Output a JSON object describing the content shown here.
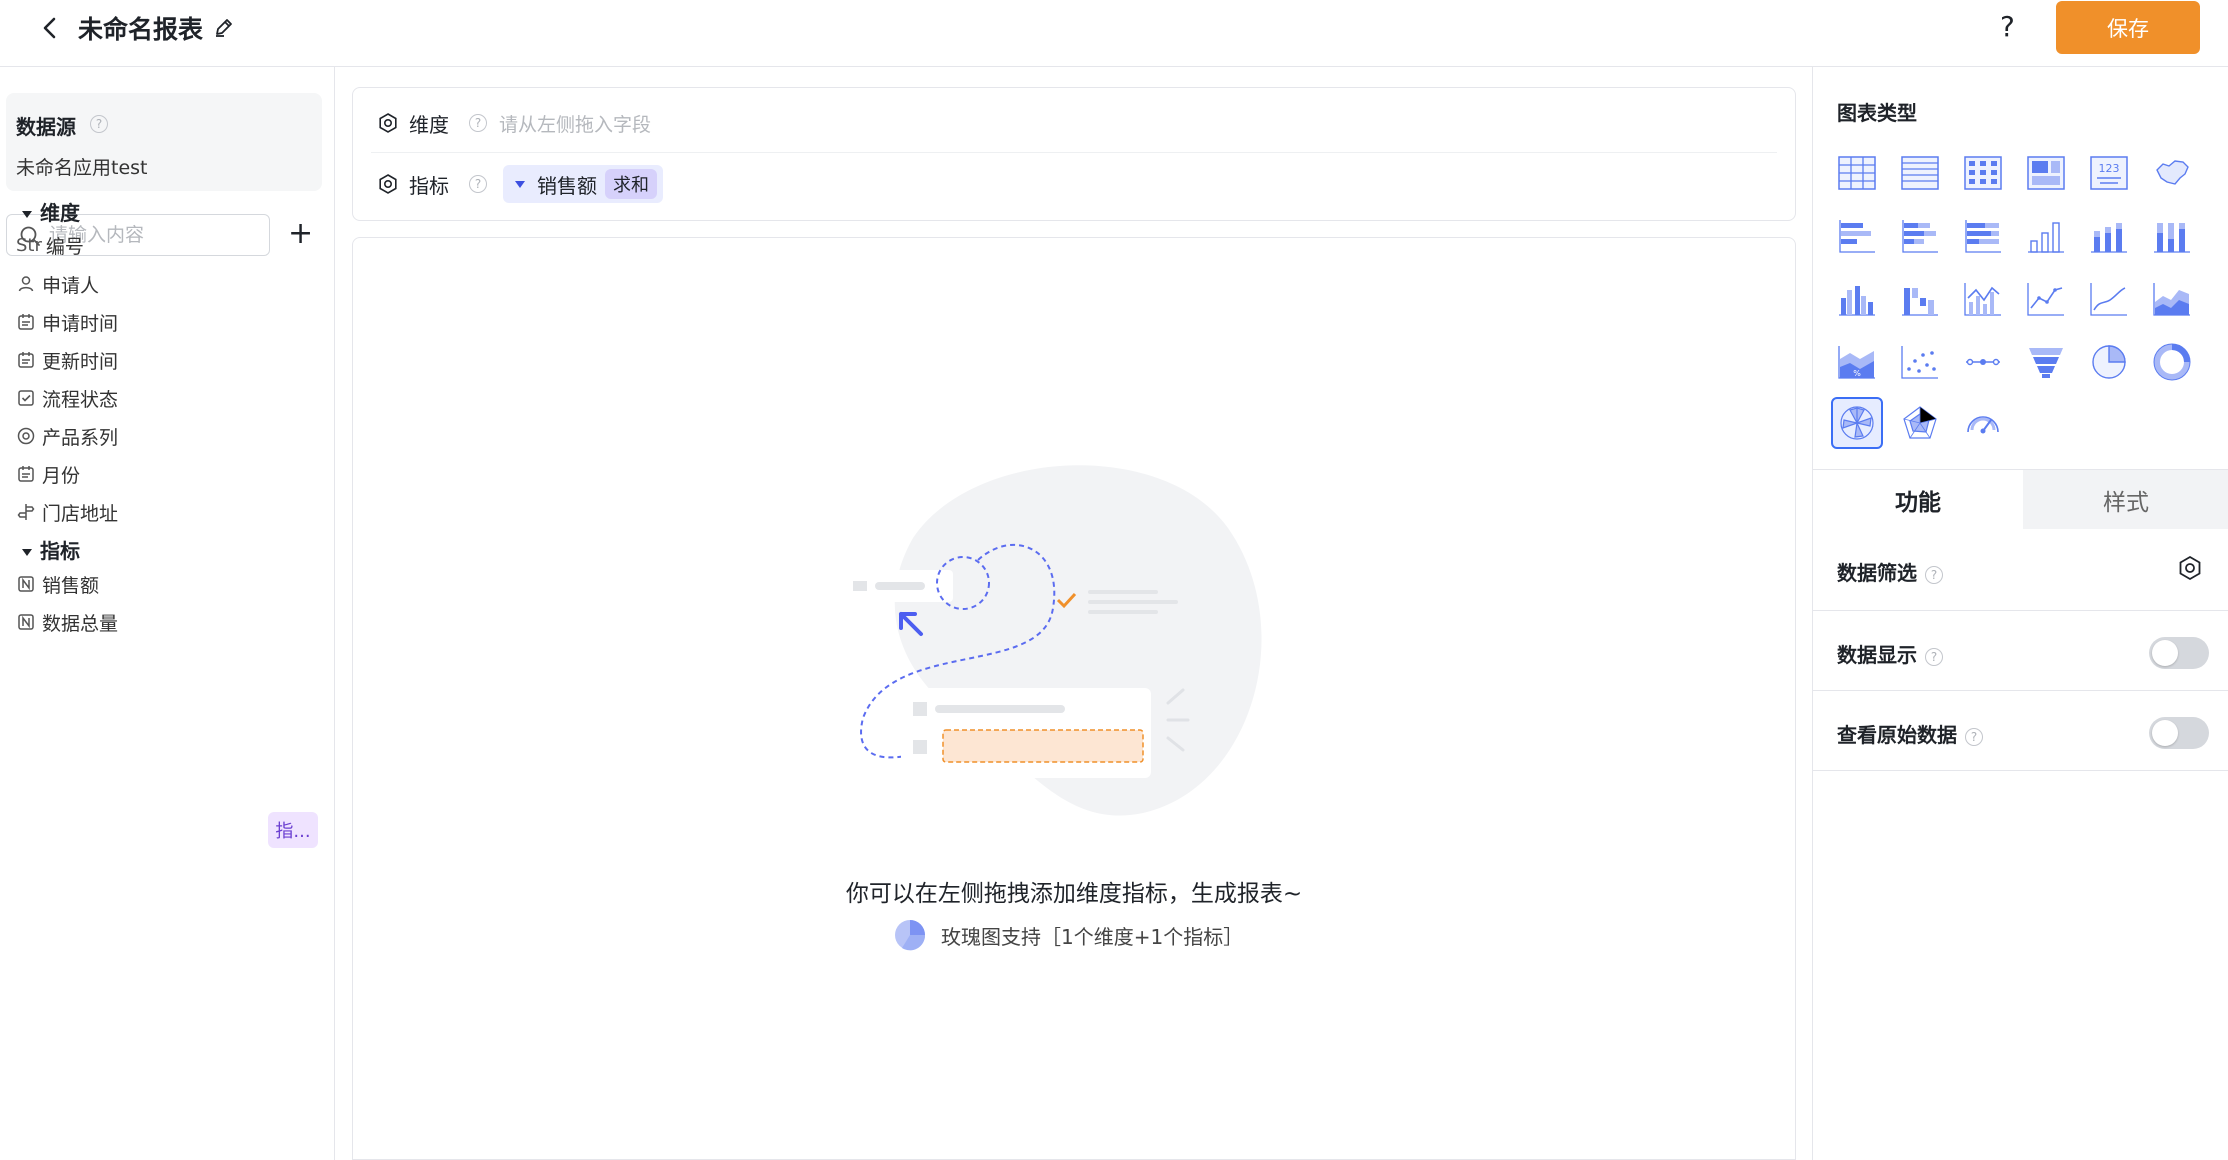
{
  "header": {
    "title": "未命名报表",
    "help": "?",
    "save_label": "保存"
  },
  "datasource": {
    "title": "数据源",
    "app_name": "未命名应用test"
  },
  "search": {
    "placeholder": "请输入内容"
  },
  "dimension_group": {
    "title": "维度",
    "fields": [
      {
        "label": "编号",
        "type_text": "Str"
      },
      {
        "label": "申请人"
      },
      {
        "label": "申请时间"
      },
      {
        "label": "更新时间"
      },
      {
        "label": "流程状态"
      },
      {
        "label": "产品系列"
      },
      {
        "label": "月份"
      },
      {
        "label": "门店地址"
      }
    ]
  },
  "metric_group": {
    "title": "指标",
    "fields": [
      {
        "label": "销售额",
        "tag": "指..."
      },
      {
        "label": "数据总量"
      }
    ]
  },
  "config": {
    "dimension_label": "维度",
    "dimension_hint": "请从左侧拖入字段",
    "metric_label": "指标",
    "metric_pill": {
      "label": "销售额",
      "agg": "求和"
    }
  },
  "canvas": {
    "empty_text": "你可以在左侧拖拽添加维度指标，生成报表~",
    "support_text": "玫瑰图支持［1个维度+1个指标］"
  },
  "right_panel": {
    "chart_type_title": "图表类型",
    "selected_chart": "rose",
    "tabs": [
      "功能",
      "样式"
    ],
    "active_tab": "功能",
    "settings": [
      {
        "label": "数据筛选",
        "control": "gear"
      },
      {
        "label": "数据显示",
        "control": "toggle",
        "on": false
      },
      {
        "label": "查看原始数据",
        "control": "toggle",
        "on": false
      }
    ]
  },
  "colors": {
    "accent": "#f0902a",
    "primary_blue": "#3b6ef5",
    "icon_blue": "#5b7cf0"
  }
}
